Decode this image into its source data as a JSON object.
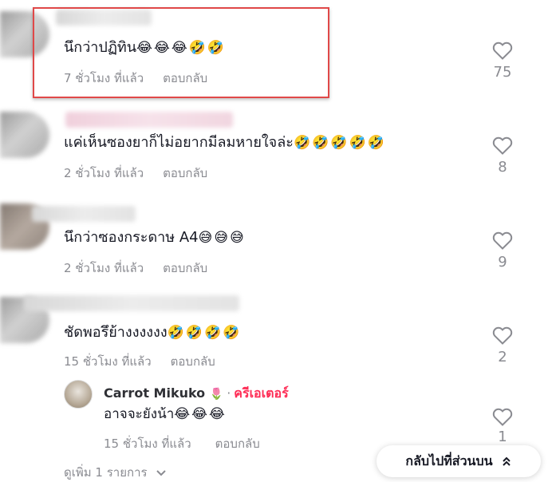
{
  "comments": [
    {
      "text": "นึกว่าปฏิทิน",
      "emojis": "😂😂😂🤣🤣",
      "time": "7 ชั่วโมง ที่แล้ว",
      "reply_label": "ตอบกลับ",
      "likes": "75"
    },
    {
      "text": "แค่เห็นซองยาก็ไม่อยากมีลมหายใจล่ะ",
      "emojis": "🤣🤣🤣🤣🤣",
      "time": "2 ชั่วโมง ที่แล้ว",
      "reply_label": "ตอบกลับ",
      "likes": "8"
    },
    {
      "text": "นึกว่าซองกระดาษ A4",
      "emojis": "😅😅😅",
      "time": "2 ชั่วโมง ที่แล้ว",
      "reply_label": "ตอบกลับ",
      "likes": "9"
    },
    {
      "text": "ชัดพอรึย้างงงงงง",
      "emojis": "🤣🤣🤣🤣",
      "time": "15 ชั่วโมง ที่แล้ว",
      "reply_label": "ตอบกลับ",
      "likes": "2"
    }
  ],
  "reply": {
    "author": "Carrot Mikuko",
    "author_badge_emoji": "🌷",
    "separator": "·",
    "creator_label": "ครีเอเตอร์",
    "text": "อาจจะยังน้า",
    "emojis": "😂😂😂",
    "time": "15 ชั่วโมง ที่แล้ว",
    "reply_label": "ตอบกลับ",
    "likes": "1"
  },
  "view_more": "ดูเพิ่ม 1 รายการ",
  "back_to_top": "กลับไปที่ส่วนบน",
  "icons": {
    "like": "heart-outline-icon",
    "chevron": "chevron-down-icon",
    "back_top": "double-chevron-up-icon"
  },
  "colors": {
    "highlight_border": "#e04848",
    "creator_accent": "#fe2c55",
    "muted_text": "#8a8b91"
  }
}
